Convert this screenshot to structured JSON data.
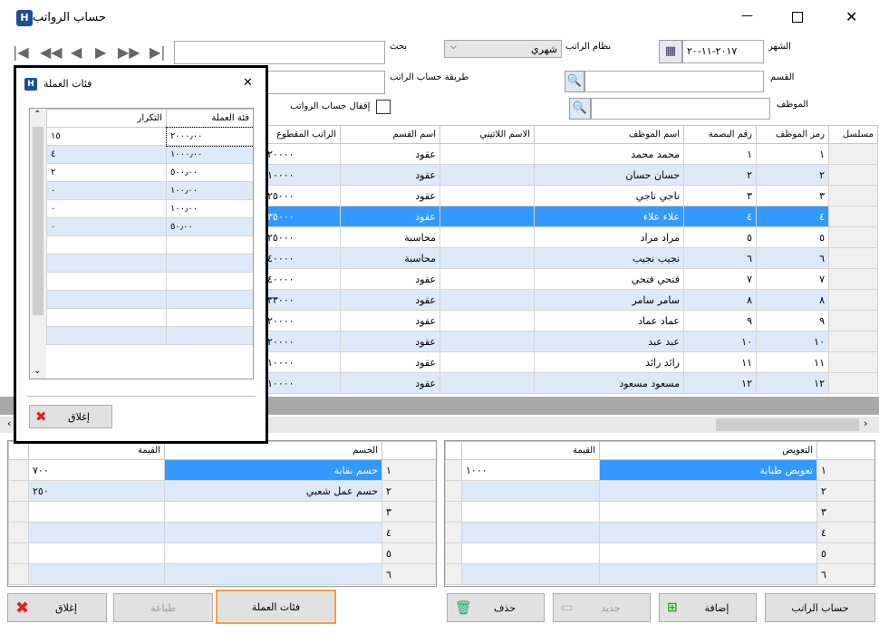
{
  "window": {
    "title": "حساب الرواتب",
    "minimize": "—",
    "maximize": "☐",
    "close": "✕"
  },
  "filters": {
    "month_label": "الشهر",
    "month_value": "٢٠١٧-١١-٢٠",
    "pay_system_label": "نظام الراتب",
    "pay_system_value": "شهري",
    "search_label": "بحث",
    "search_value": "",
    "department_label": "القسم",
    "calc_method_label": "طريقة حساب الراتب",
    "employee_label": "الموظف",
    "close_calc_label": "إقفال حساب الرواتب"
  },
  "main_table": {
    "headers": {
      "serial": "مسلسل",
      "emp_code": "رمز الموظف",
      "fingerprint": "رقم البصمة",
      "emp_name": "اسم الموظف",
      "latin_name": "الاسم اللاتيني",
      "dept_name": "اسم القسم",
      "deducted_salary": "الراتب المقطوع"
    },
    "rows": [
      {
        "code": "١",
        "fp": "١",
        "name": "محمد محمد",
        "dept": "عقود",
        "salary": "٢٠٠٠٠"
      },
      {
        "code": "٢",
        "fp": "٢",
        "name": "حسان حسان",
        "dept": "عقود",
        "salary": "١٠٠٠٠"
      },
      {
        "code": "٣",
        "fp": "٣",
        "name": "ناجي ناجي",
        "dept": "عقود",
        "salary": "٢٥٠٠٠"
      },
      {
        "code": "٤",
        "fp": "٤",
        "name": "علاء علاء",
        "dept": "عقود",
        "salary": "٣٥٠٠٠"
      },
      {
        "code": "٥",
        "fp": "٥",
        "name": "مراد مراد",
        "dept": "محاسبة",
        "salary": "٢٥٠٠٠"
      },
      {
        "code": "٦",
        "fp": "٦",
        "name": "نجيب نجيب",
        "dept": "محاسبة",
        "salary": "٤٠٠٠٠"
      },
      {
        "code": "٧",
        "fp": "٧",
        "name": "فتحي فتحي",
        "dept": "عقود",
        "salary": "٤٠٠٠٠"
      },
      {
        "code": "٨",
        "fp": "٨",
        "name": "سامر سامر",
        "dept": "عقود",
        "salary": "٣٣٠٠٠"
      },
      {
        "code": "٩",
        "fp": "٩",
        "name": "عماد عماد",
        "dept": "عقود",
        "salary": "٢٠٠٠٠"
      },
      {
        "code": "١٠",
        "fp": "١٠",
        "name": "عبد عبد",
        "dept": "عقود",
        "salary": "٢٠٠٠٠"
      },
      {
        "code": "١١",
        "fp": "١١",
        "name": "رائد رائد",
        "dept": "عقود",
        "salary": "١٠٠٠٠"
      },
      {
        "code": "١٢",
        "fp": "١٢",
        "name": "مسعود مسعود",
        "dept": "عقود",
        "salary": "١٠٠٠٠"
      }
    ]
  },
  "compensation_table": {
    "headers": {
      "compensation": "التعويض",
      "value": "القيمة"
    },
    "rownums": [
      "١",
      "٢",
      "٣",
      "٤",
      "٥",
      "٦"
    ],
    "rows": [
      {
        "name": "تعويض طبابة",
        "value": "١٠٠٠"
      }
    ]
  },
  "deduction_table": {
    "headers": {
      "deduction": "الحسم",
      "value": "القيمة"
    },
    "rownums": [
      "١",
      "٢",
      "٣",
      "٤",
      "٥",
      "٦"
    ],
    "rows": [
      {
        "name": "حسم نقابة",
        "value": "٧٠٠"
      },
      {
        "name": "حسم عمل شعبي",
        "value": "٢٥٠"
      }
    ]
  },
  "dialog": {
    "title": "فئات العملة",
    "close_icon": "✕",
    "headers": {
      "category": "فئة العملة",
      "count": "التكرار"
    },
    "rows": [
      {
        "category": "٢٠٠٠٫٠٠",
        "count": "١٥"
      },
      {
        "category": "١٠٠٠٫٠٠",
        "count": "٤"
      },
      {
        "category": "٥٠٠٫٠٠",
        "count": "٢"
      },
      {
        "category": "١٠٠٫٠٠",
        "count": "٠"
      },
      {
        "category": "١٠٠٫٠٠",
        "count": "٠"
      },
      {
        "category": "٥٠٫٠٠",
        "count": "٠"
      }
    ],
    "close_button": "إغلاق"
  },
  "buttons": {
    "close": "إغلاق",
    "print": "طباعة",
    "currency": "فئات العملة",
    "delete": "حذف",
    "new": "جديد",
    "add": "إضافة",
    "salary_calc": "حساب الراتب"
  },
  "colors": {
    "selection": "#3399ff",
    "alt_row": "#dce9f9",
    "highlight_border": "#f0a04b"
  }
}
